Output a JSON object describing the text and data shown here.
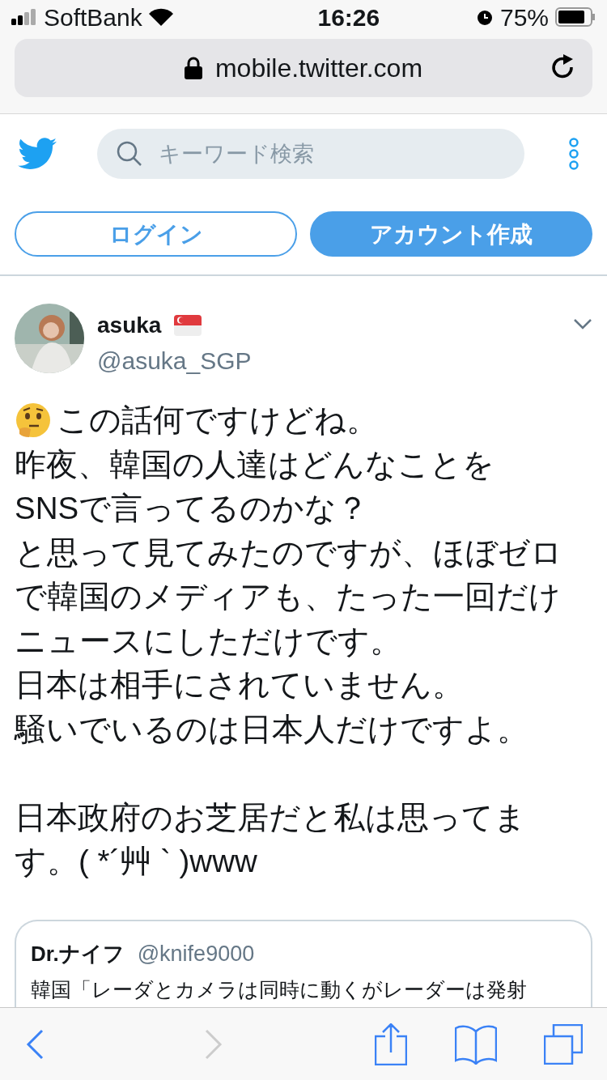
{
  "status_bar": {
    "carrier": "SoftBank",
    "time": "16:26",
    "battery": "75%"
  },
  "address_bar": {
    "url": "mobile.twitter.com"
  },
  "header": {
    "search": {
      "placeholder": "キーワード検索"
    },
    "buttons": [
      {
        "label": "ログイン",
        "kind": "outline"
      },
      {
        "label": "アカウント作成",
        "kind": "filled"
      }
    ]
  },
  "tweet": {
    "name": "asuka",
    "handle": "@asuka_SGP",
    "lines": [
      "この話何ですけどね。",
      "昨夜、韓国の人達はどんなことを",
      "SNSで言ってるのかな？",
      "と思って見てみたのですが、ほぼゼロ",
      "で韓国のメディアも、たった一回だけ",
      "ニュースにしただけです。",
      "日本は相手にされていません。",
      "騒いでいるのは日本人だけですよ。",
      "日本政府のお芝居だと私は思ってま",
      "す。( *´艸 ` )www"
    ],
    "quoted": {
      "name": "Dr.ナイフ",
      "handle": "@knife9000",
      "text": "韓国「レーダとカメラは同時に動くがレーダーは発射"
    }
  }
}
